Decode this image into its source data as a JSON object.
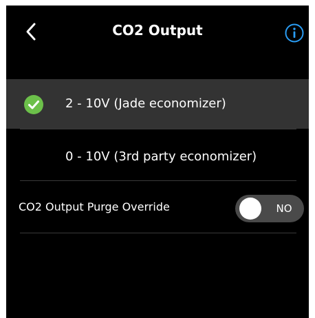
{
  "header": {
    "title": "CO2 Output",
    "back_icon": "chevron-left-icon",
    "info_icon": "info-icon"
  },
  "options": [
    {
      "label": "2 - 10V (Jade economizer)",
      "selected": true,
      "icon": "check-circle-icon"
    },
    {
      "label": "0 - 10V (3rd party economizer)",
      "selected": false
    }
  ],
  "purge_override": {
    "label": "CO2 Output Purge Override",
    "toggle_text": "NO",
    "state": "off"
  },
  "colors": {
    "background": "#000000",
    "selected_row": "#333333",
    "accent_info": "#2a9df4",
    "check_green": "#6cc04a",
    "toggle_track": "#4a4a4a",
    "divider": "#3a3a3a"
  }
}
